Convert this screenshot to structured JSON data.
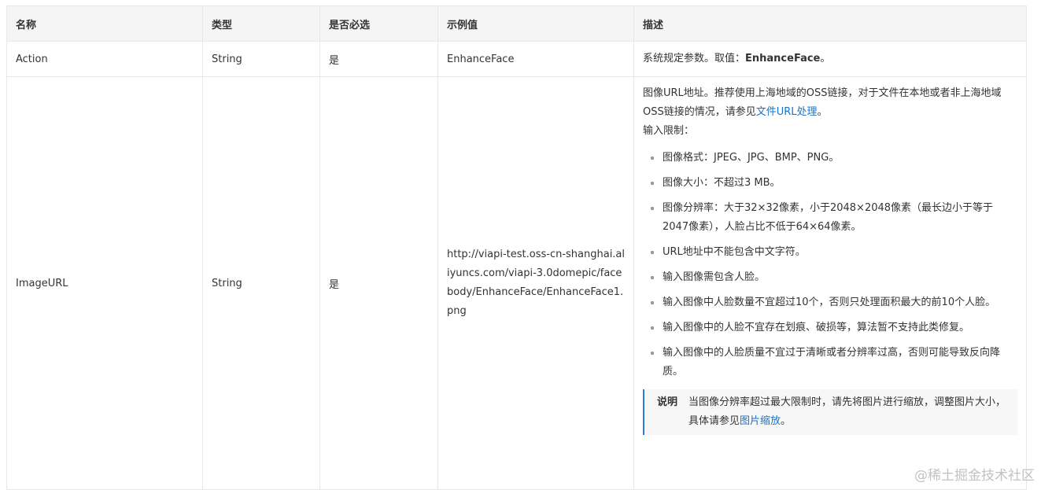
{
  "table": {
    "headers": [
      "名称",
      "类型",
      "是否必选",
      "示例值",
      "描述"
    ],
    "rows": [
      {
        "name": "Action",
        "type": "String",
        "required": "是",
        "example": "EnhanceFace",
        "description": {
          "prefix": "系统规定参数。取值：",
          "strong": "EnhanceFace",
          "suffix": "。"
        }
      },
      {
        "name": "ImageURL",
        "type": "String",
        "required": "是",
        "example": "http://viapi-test.oss-cn-shanghai.aliyuncs.com/viapi-3.0domepic/facebody/EnhanceFace/EnhanceFace1.png",
        "description": {
          "intro": "图像URL地址。推荐使用上海地域的OSS链接，对于文件在本地或者非上海地域OSS链接的情况，请参见",
          "intro_link": "文件URL处理",
          "intro_end": "。",
          "limits_title": "输入限制：",
          "limits": [
            "图像格式：JPEG、JPG、BMP、PNG。",
            "图像大小：不超过3 MB。",
            "图像分辨率：大于32×32像素，小于2048×2048像素（最长边小于等于2047像素），人脸占比不低于64×64像素。",
            "URL地址中不能包含中文字符。",
            "输入图像需包含人脸。",
            "输入图像中人脸数量不宜超过10个，否则只处理面积最大的前10个人脸。",
            "输入图像中的人脸不宜存在划痕、破损等，算法暂不支持此类修复。",
            "输入图像中的人脸质量不宜过于清晰或者分辨率过高，否则可能导致反向降质。"
          ],
          "note": {
            "label": "说明",
            "text": "当图像分辨率超过最大限制时，请先将图片进行缩放，调整图片大小，具体请参见",
            "link": "图片缩放",
            "end": "。"
          }
        }
      }
    ]
  },
  "watermark": "@稀土掘金技术社区"
}
